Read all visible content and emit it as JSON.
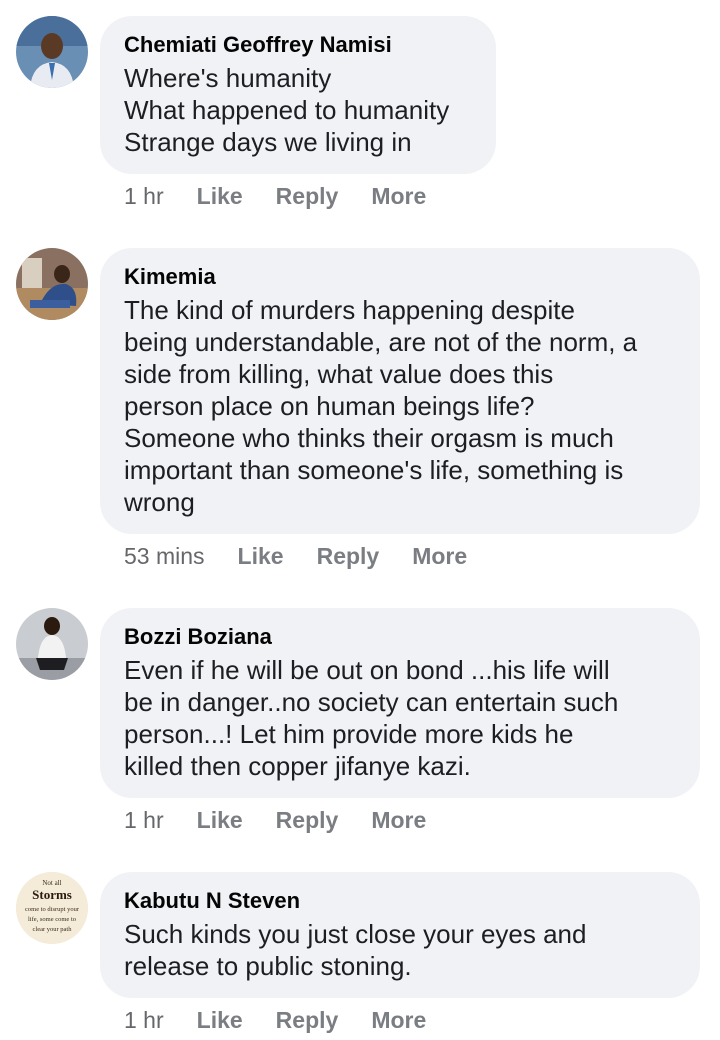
{
  "comments": [
    {
      "author": "Chemiati Geoffrey Namisi",
      "text": "Where's humanity\nWhat happened to humanity\nStrange days we living in",
      "time": "1 hr",
      "like": "Like",
      "reply": "Reply",
      "more": "More",
      "avatar_icon": "profile-photo"
    },
    {
      "author": "Kimemia",
      "text": "The kind of murders happening despite\nbeing understandable, are not of the norm, a\nside from killing, what value does this\nperson place on human beings life?\nSomeone who thinks their orgasm is much\nimportant than someone's life, something is\nwrong",
      "time": "53 mins",
      "like": "Like",
      "reply": "Reply",
      "more": "More",
      "avatar_icon": "profile-photo"
    },
    {
      "author": "Bozzi Boziana",
      "text": "Even if he will be out on bond ...his life will\nbe in danger..no society can entertain such\nperson...! Let him provide more kids he\nkilled then copper jifanye kazi.",
      "time": "1 hr",
      "like": "Like",
      "reply": "Reply",
      "more": "More",
      "avatar_icon": "profile-photo"
    },
    {
      "author": "Kabutu N Steven",
      "text": "Such kinds you just close your eyes and\nrelease to public stoning.",
      "time": "1 hr",
      "like": "Like",
      "reply": "Reply",
      "more": "More",
      "avatar_icon": "quote-image",
      "avatar_text": [
        "Not all",
        "Storms",
        "come to disrupt your",
        "life, some come to",
        "clear your path"
      ]
    }
  ],
  "colors": {
    "bubble": "#f0f2f5",
    "author": "#050505",
    "text": "#1c1e21",
    "meta": "#65676b"
  }
}
